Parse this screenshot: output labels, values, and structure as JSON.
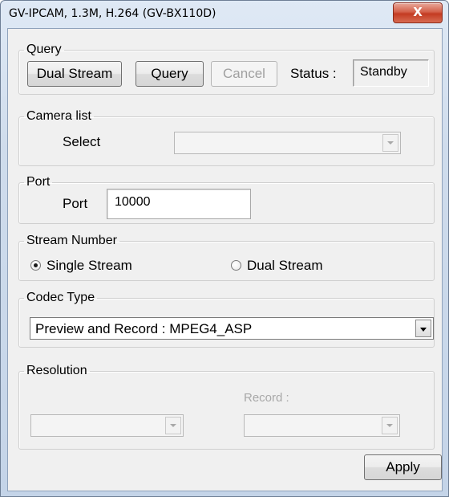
{
  "window": {
    "title": "GV-IPCAM, 1.3M, H.264 (GV-BX110D)",
    "close_label": "X"
  },
  "query": {
    "group_label": "Query",
    "dual_stream_label": "Dual Stream",
    "query_label": "Query",
    "cancel_label": "Cancel",
    "status_label": "Status :",
    "status_value": "Standby"
  },
  "camera_list": {
    "group_label": "Camera list",
    "select_label": "Select",
    "select_value": ""
  },
  "port": {
    "group_label": "Port",
    "port_label": "Port",
    "port_value": "10000"
  },
  "stream_number": {
    "group_label": "Stream Number",
    "options": [
      {
        "label": "Single Stream",
        "selected": true
      },
      {
        "label": "Dual Stream",
        "selected": false
      }
    ]
  },
  "codec_type": {
    "group_label": "Codec Type",
    "selected_value": "Preview and Record : MPEG4_ASP"
  },
  "resolution": {
    "group_label": "Resolution",
    "record_label": "Record :",
    "left_value": "",
    "right_value": ""
  },
  "footer": {
    "apply_label": "Apply"
  }
}
